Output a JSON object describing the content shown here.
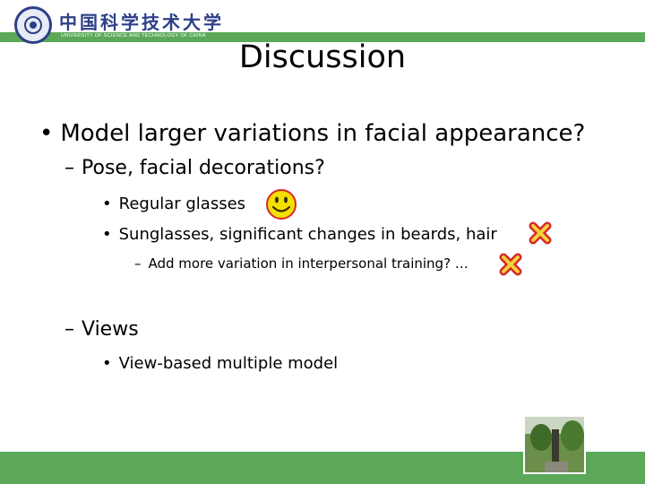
{
  "header": {
    "university_cn": "中国科学技术大学",
    "university_en": "UNIVERSITY OF SCIENCE AND TECHNOLOGY OF CHINA"
  },
  "slide": {
    "title": "Discussion",
    "bullets": [
      {
        "marker": "•",
        "text": "Model larger variations in facial appearance?"
      },
      {
        "marker": "–",
        "text": "Pose, facial decorations?"
      },
      {
        "marker": "•",
        "text": "Regular glasses"
      },
      {
        "marker": "•",
        "text": "Sunglasses, significant changes in beards, hair"
      },
      {
        "marker": "–",
        "text": "Add more variation in interpersonal training? …"
      },
      {
        "marker": "–",
        "text": "Views"
      },
      {
        "marker": "•",
        "text": "View-based multiple model"
      }
    ]
  },
  "icons": {
    "positive": "smiley-icon",
    "negative": "cross-icon"
  },
  "colors": {
    "band_green": "#5aa858",
    "logo_blue": "#2d3f86",
    "smiley_yellow": "#f2e000",
    "cross_red": "#d8262a",
    "cross_yellow": "#f3d23a"
  }
}
